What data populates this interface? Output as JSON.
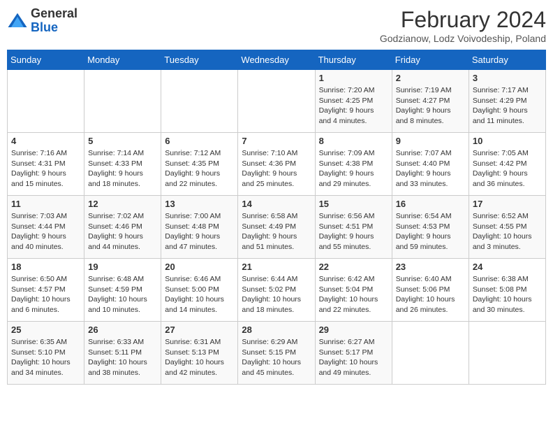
{
  "header": {
    "logo_general": "General",
    "logo_blue": "Blue",
    "month_title": "February 2024",
    "subtitle": "Godzianow, Lodz Voivodeship, Poland"
  },
  "weekdays": [
    "Sunday",
    "Monday",
    "Tuesday",
    "Wednesday",
    "Thursday",
    "Friday",
    "Saturday"
  ],
  "weeks": [
    [
      {
        "day": "",
        "info": ""
      },
      {
        "day": "",
        "info": ""
      },
      {
        "day": "",
        "info": ""
      },
      {
        "day": "",
        "info": ""
      },
      {
        "day": "1",
        "info": "Sunrise: 7:20 AM\nSunset: 4:25 PM\nDaylight: 9 hours and 4 minutes."
      },
      {
        "day": "2",
        "info": "Sunrise: 7:19 AM\nSunset: 4:27 PM\nDaylight: 9 hours and 8 minutes."
      },
      {
        "day": "3",
        "info": "Sunrise: 7:17 AM\nSunset: 4:29 PM\nDaylight: 9 hours and 11 minutes."
      }
    ],
    [
      {
        "day": "4",
        "info": "Sunrise: 7:16 AM\nSunset: 4:31 PM\nDaylight: 9 hours and 15 minutes."
      },
      {
        "day": "5",
        "info": "Sunrise: 7:14 AM\nSunset: 4:33 PM\nDaylight: 9 hours and 18 minutes."
      },
      {
        "day": "6",
        "info": "Sunrise: 7:12 AM\nSunset: 4:35 PM\nDaylight: 9 hours and 22 minutes."
      },
      {
        "day": "7",
        "info": "Sunrise: 7:10 AM\nSunset: 4:36 PM\nDaylight: 9 hours and 25 minutes."
      },
      {
        "day": "8",
        "info": "Sunrise: 7:09 AM\nSunset: 4:38 PM\nDaylight: 9 hours and 29 minutes."
      },
      {
        "day": "9",
        "info": "Sunrise: 7:07 AM\nSunset: 4:40 PM\nDaylight: 9 hours and 33 minutes."
      },
      {
        "day": "10",
        "info": "Sunrise: 7:05 AM\nSunset: 4:42 PM\nDaylight: 9 hours and 36 minutes."
      }
    ],
    [
      {
        "day": "11",
        "info": "Sunrise: 7:03 AM\nSunset: 4:44 PM\nDaylight: 9 hours and 40 minutes."
      },
      {
        "day": "12",
        "info": "Sunrise: 7:02 AM\nSunset: 4:46 PM\nDaylight: 9 hours and 44 minutes."
      },
      {
        "day": "13",
        "info": "Sunrise: 7:00 AM\nSunset: 4:48 PM\nDaylight: 9 hours and 47 minutes."
      },
      {
        "day": "14",
        "info": "Sunrise: 6:58 AM\nSunset: 4:49 PM\nDaylight: 9 hours and 51 minutes."
      },
      {
        "day": "15",
        "info": "Sunrise: 6:56 AM\nSunset: 4:51 PM\nDaylight: 9 hours and 55 minutes."
      },
      {
        "day": "16",
        "info": "Sunrise: 6:54 AM\nSunset: 4:53 PM\nDaylight: 9 hours and 59 minutes."
      },
      {
        "day": "17",
        "info": "Sunrise: 6:52 AM\nSunset: 4:55 PM\nDaylight: 10 hours and 3 minutes."
      }
    ],
    [
      {
        "day": "18",
        "info": "Sunrise: 6:50 AM\nSunset: 4:57 PM\nDaylight: 10 hours and 6 minutes."
      },
      {
        "day": "19",
        "info": "Sunrise: 6:48 AM\nSunset: 4:59 PM\nDaylight: 10 hours and 10 minutes."
      },
      {
        "day": "20",
        "info": "Sunrise: 6:46 AM\nSunset: 5:00 PM\nDaylight: 10 hours and 14 minutes."
      },
      {
        "day": "21",
        "info": "Sunrise: 6:44 AM\nSunset: 5:02 PM\nDaylight: 10 hours and 18 minutes."
      },
      {
        "day": "22",
        "info": "Sunrise: 6:42 AM\nSunset: 5:04 PM\nDaylight: 10 hours and 22 minutes."
      },
      {
        "day": "23",
        "info": "Sunrise: 6:40 AM\nSunset: 5:06 PM\nDaylight: 10 hours and 26 minutes."
      },
      {
        "day": "24",
        "info": "Sunrise: 6:38 AM\nSunset: 5:08 PM\nDaylight: 10 hours and 30 minutes."
      }
    ],
    [
      {
        "day": "25",
        "info": "Sunrise: 6:35 AM\nSunset: 5:10 PM\nDaylight: 10 hours and 34 minutes."
      },
      {
        "day": "26",
        "info": "Sunrise: 6:33 AM\nSunset: 5:11 PM\nDaylight: 10 hours and 38 minutes."
      },
      {
        "day": "27",
        "info": "Sunrise: 6:31 AM\nSunset: 5:13 PM\nDaylight: 10 hours and 42 minutes."
      },
      {
        "day": "28",
        "info": "Sunrise: 6:29 AM\nSunset: 5:15 PM\nDaylight: 10 hours and 45 minutes."
      },
      {
        "day": "29",
        "info": "Sunrise: 6:27 AM\nSunset: 5:17 PM\nDaylight: 10 hours and 49 minutes."
      },
      {
        "day": "",
        "info": ""
      },
      {
        "day": "",
        "info": ""
      }
    ]
  ]
}
